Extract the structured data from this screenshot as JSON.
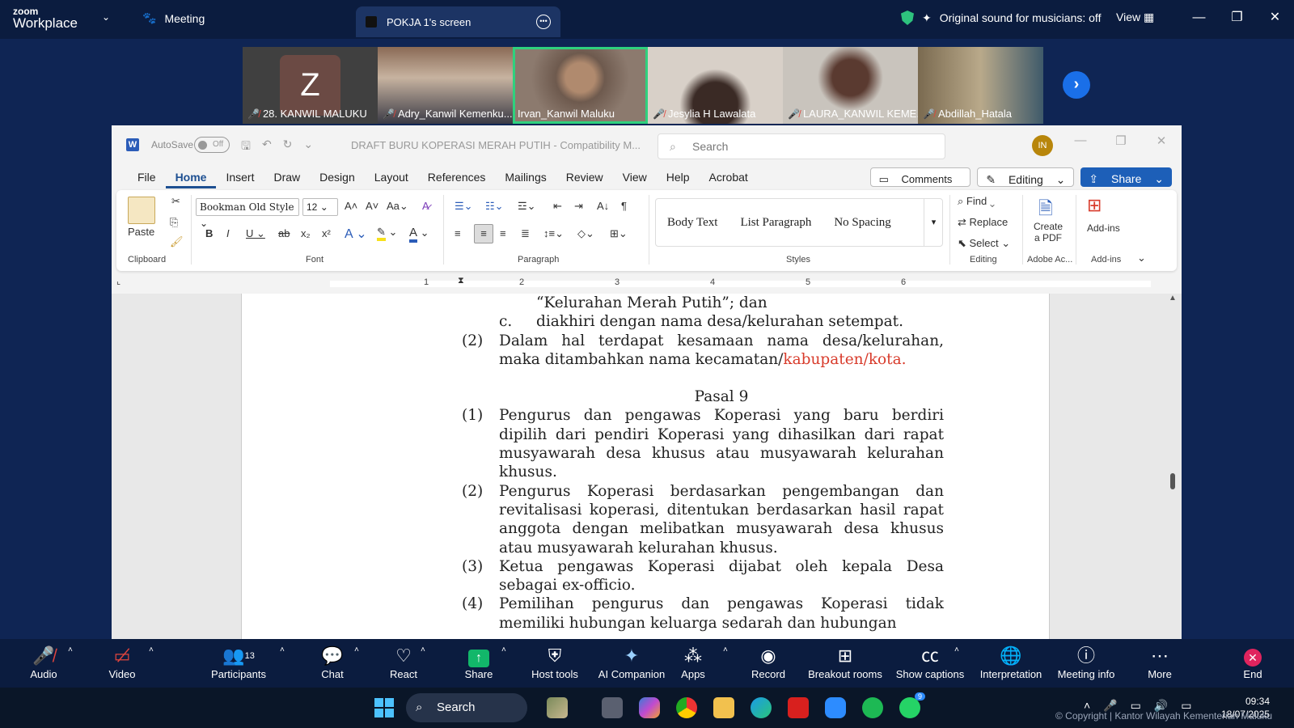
{
  "zoom": {
    "logo_line1": "zoom",
    "logo_line2": "Workplace",
    "tab_meeting": "Meeting",
    "tab_share": "POKJA 1's screen",
    "sound_label": "Original sound for musicians: off",
    "view_label": "View",
    "participants": [
      {
        "name": "28. KANWIL MALUKU",
        "initial": "Z",
        "muted": true
      },
      {
        "name": "Adry_Kanwil Kemenku...",
        "muted": true
      },
      {
        "name": "Irvan_Kanwil Maluku",
        "muted": false,
        "active": true
      },
      {
        "name": "Jesylia H Lawalata",
        "muted": true
      },
      {
        "name": "LAURA_KANWIL KEME...",
        "muted": true
      },
      {
        "name": "Abdillah_Hatala",
        "muted": true
      }
    ],
    "toolbar": {
      "audio": "Audio",
      "video": "Video",
      "participants": "Participants",
      "participants_count": "13",
      "chat": "Chat",
      "react": "React",
      "share": "Share",
      "host_tools": "Host tools",
      "ai_companion": "AI Companion",
      "apps": "Apps",
      "record": "Record",
      "breakout": "Breakout rooms",
      "captions": "Show captions",
      "interpretation": "Interpretation",
      "meeting_info": "Meeting info",
      "more": "More",
      "end": "End"
    }
  },
  "word": {
    "autosave": "AutoSave",
    "autosave_state": "Off",
    "doc_title": "DRAFT BURU KOPERASI MERAH PUTIH  -  Compatibility M...",
    "search_placeholder": "Search",
    "user_initials": "IN",
    "menu": [
      "File",
      "Home",
      "Insert",
      "Draw",
      "Design",
      "Layout",
      "References",
      "Mailings",
      "Review",
      "View",
      "Help",
      "Acrobat"
    ],
    "comments": "Comments",
    "editing": "Editing",
    "share": "Share",
    "ribbon": {
      "paste": "Paste",
      "clipboard": "Clipboard",
      "font_name": "Bookman Old Style",
      "font_size": "12",
      "font": "Font",
      "paragraph": "Paragraph",
      "styles": "Styles",
      "style1": "Body Text",
      "style2": "List Paragraph",
      "style3": "No Spacing",
      "find": "Find",
      "replace": "Replace",
      "select": "Select",
      "editing": "Editing",
      "create_pdf_1": "Create",
      "create_pdf_2": "a PDF",
      "adobe": "Adobe Ac...",
      "addins": "Add-ins",
      "addins_group": "Add-ins"
    },
    "ruler_numbers": [
      "1",
      "2",
      "3",
      "4",
      "5",
      "6"
    ],
    "doc": {
      "line_a": "“Kelurahan Merah Putih”; dan",
      "item_c_num": "c.",
      "item_c": "diakhiri dengan nama desa/kelurahan setempat.",
      "p2_num": "(2)",
      "p2_text": "Dalam hal terdapat kesamaan nama desa/kelurahan, maka ditambahkan nama kecamatan/",
      "p2_red": "kabupaten/kota.",
      "pasal": "Pasal 9",
      "s1_num": "(1)",
      "s1": "Pengurus dan pengawas Koperasi yang baru berdiri dipilih dari pendiri Koperasi yang dihasilkan dari rapat musyawarah desa khusus atau musyawarah kelurahan khusus.",
      "s2_num": "(2)",
      "s2": "Pengurus Koperasi berdasarkan pengembangan dan revitalisasi koperasi, ditentukan berdasarkan hasil rapat anggota dengan melibatkan musyawarah desa khusus atau musyawarah kelurahan khusus.",
      "s3_num": "(3)",
      "s3": "Ketua pengawas Koperasi dijabat oleh kepala Desa sebagai ex-officio.",
      "s4_num": "(4)",
      "s4": "Pemilihan pengurus dan pengawas Koperasi tidak memiliki hubungan keluarga sedarah dan hubungan"
    }
  },
  "taskbar": {
    "search": "Search",
    "time": "09:34",
    "date": "18/07/2025",
    "copyright": "© Copyright | Kantor Wilayah Kementerian Maluku",
    "whatsapp_badge": "9"
  }
}
